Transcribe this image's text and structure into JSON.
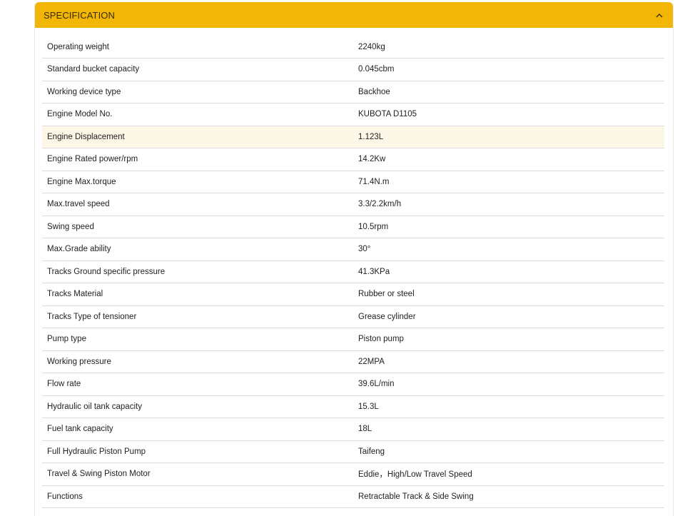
{
  "panel": {
    "title": "SPECIFICATION",
    "toggle_icon": "chevron-up-icon",
    "accent_color": "#f2b606",
    "highlight_row_color": "#fdf7e7"
  },
  "specs": [
    {
      "label": "Operating weight",
      "value": "2240kg"
    },
    {
      "label": "Standard bucket capacity",
      "value": "0.045cbm"
    },
    {
      "label": "Working device type",
      "value": "Backhoe"
    },
    {
      "label": "Engine Model No.",
      "value": "KUBOTA D1105"
    },
    {
      "label": "Engine Displacement",
      "value": "1.123L",
      "highlighted": true
    },
    {
      "label": "Engine Rated power/rpm",
      "value": "14.2Kw"
    },
    {
      "label": "Engine Max.torque",
      "value": "71.4N.m"
    },
    {
      "label": "Max.travel speed",
      "value": "3.3/2.2km/h"
    },
    {
      "label": "Swing speed",
      "value": "10.5rpm"
    },
    {
      "label": "Max.Grade ability",
      "value": "30°"
    },
    {
      "label": "Tracks Ground specific pressure",
      "value": "41.3KPa"
    },
    {
      "label": "Tracks Material",
      "value": "Rubber or steel"
    },
    {
      "label": "Tracks Type of tensioner",
      "value": "Grease cylinder"
    },
    {
      "label": "Pump type",
      "value": "Piston pump"
    },
    {
      "label": "Working pressure",
      "value": "22MPA"
    },
    {
      "label": "Flow rate",
      "value": "39.6L/min"
    },
    {
      "label": "Hydraulic oil tank capacity",
      "value": "15.3L"
    },
    {
      "label": "Fuel tank capacity",
      "value": "18L"
    },
    {
      "label": "Full Hydraulic Piston Pump",
      "value": "Taifeng"
    },
    {
      "label": "Travel & Swing Piston Motor",
      "value": "Eddie，High/Low Travel Speed"
    },
    {
      "label": "Functions",
      "value": "Retractable Track & Side Swing"
    }
  ]
}
